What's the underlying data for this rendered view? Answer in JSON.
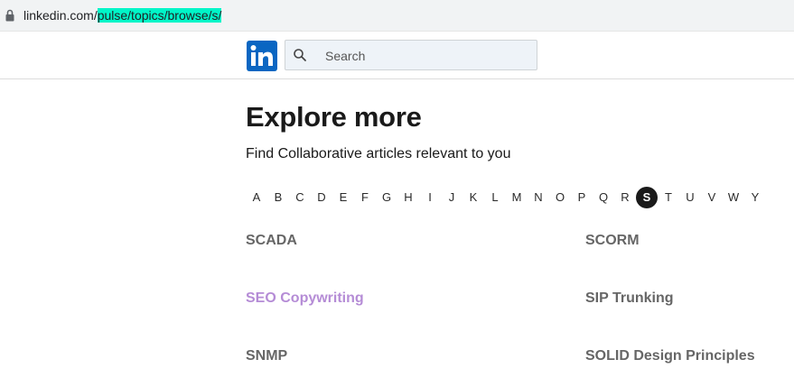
{
  "browser": {
    "url_host": "linkedin.com/",
    "url_path": "pulse/topics/browse/s/"
  },
  "header": {
    "logo_text": "in",
    "search_placeholder": "Search",
    "brand_color": "#0a66c2"
  },
  "main": {
    "title": "Explore more",
    "subtitle": "Find Collaborative articles relevant to you",
    "alphabet": [
      "A",
      "B",
      "C",
      "D",
      "E",
      "F",
      "G",
      "H",
      "I",
      "J",
      "K",
      "L",
      "M",
      "N",
      "O",
      "P",
      "Q",
      "R",
      "S",
      "T",
      "U",
      "V",
      "W",
      "Y"
    ],
    "active_letter": "S",
    "topics": [
      {
        "label": "SCADA",
        "visited": false
      },
      {
        "label": "SCORM",
        "visited": false
      },
      {
        "label": "SEO Copywriting",
        "visited": true
      },
      {
        "label": "SIP Trunking",
        "visited": false
      },
      {
        "label": "SNMP",
        "visited": false
      },
      {
        "label": "SOLID Design Principles",
        "visited": false
      }
    ]
  },
  "colors": {
    "topic": "#666666",
    "topic_visited": "#b58cd6",
    "url_highlight": "#00f5c8"
  }
}
